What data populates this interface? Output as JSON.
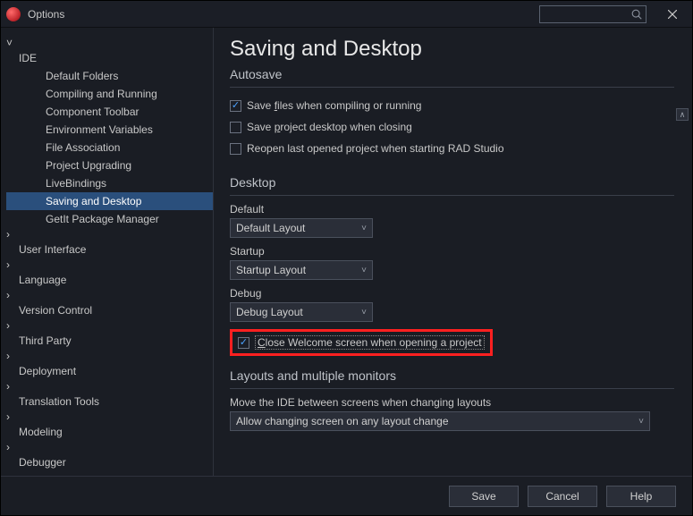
{
  "window": {
    "title": "Options"
  },
  "tree": {
    "root": "IDE",
    "ide_children": [
      "Default Folders",
      "Compiling and Running",
      "Component Toolbar",
      "Environment Variables",
      "File Association",
      "Project Upgrading",
      "LiveBindings",
      "Saving and Desktop",
      "GetIt Package Manager"
    ],
    "siblings": [
      "User Interface",
      "Language",
      "Version Control",
      "Third Party",
      "Deployment",
      "Translation Tools",
      "Modeling",
      "Debugger"
    ],
    "selected": "Saving and Desktop"
  },
  "page": {
    "title": "Saving and Desktop",
    "autosave": {
      "heading": "Autosave",
      "save_files": {
        "label": "Save files when compiling or running",
        "checked": true,
        "accel": "f"
      },
      "save_desktop": {
        "label": "Save project desktop when closing",
        "checked": false,
        "accel": "p"
      },
      "reopen_last": {
        "label": "Reopen last opened project when starting RAD Studio",
        "checked": false,
        "accel": ""
      }
    },
    "desktop": {
      "heading": "Desktop",
      "default": {
        "label": "Default",
        "value": "Default Layout"
      },
      "startup": {
        "label": "Startup",
        "value": "Startup Layout"
      },
      "debug": {
        "label": "Debug",
        "value": "Debug Layout"
      },
      "close_welcome": {
        "label": "Close Welcome screen when opening a project",
        "checked": true,
        "accel": "C"
      }
    },
    "layouts": {
      "heading": "Layouts and multiple monitors",
      "move_label": "Move the IDE between screens when changing layouts",
      "move_value": "Allow changing screen on any layout change"
    }
  },
  "footer": {
    "save": "Save",
    "cancel": "Cancel",
    "help": "Help"
  }
}
